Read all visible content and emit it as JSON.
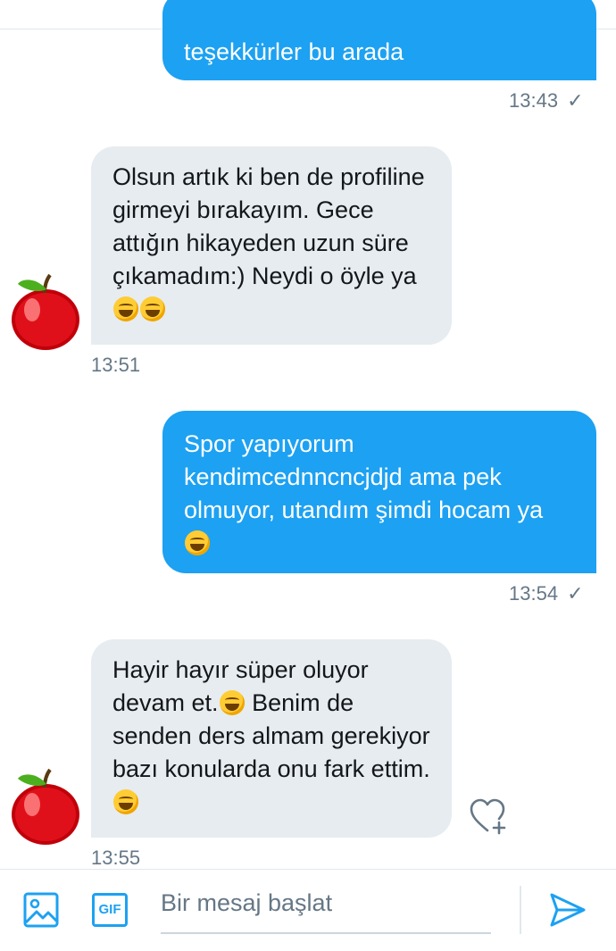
{
  "messages": [
    {
      "direction": "outgoing",
      "text": "teşekkürler bu arada",
      "time": "13:43"
    },
    {
      "direction": "incoming",
      "text": "Olsun artık ki ben de profiline girmeyi bırakayım. Gece attığın hikayeden uzun süre çıkamadım:) Neydi o öyle ya",
      "emojis": [
        "face-with-tears-of-joy",
        "face-with-tears-of-joy"
      ],
      "time": "13:51"
    },
    {
      "direction": "outgoing",
      "text": "Spor yapıyorum kendimcednncncjdjd ama pek olmuyor, utandım şimdi hocam ya",
      "emojis": [
        "face-with-tears-of-joy"
      ],
      "time": "13:54"
    },
    {
      "direction": "incoming",
      "text_part1": "Hayir hayır süper oluyor devam et.",
      "text_part2": " Benim de senden ders almam gerekiyor bazı konularda onu fark ettim.",
      "emojis": [
        "face-with-tears-of-joy",
        "face-with-tears-of-joy"
      ],
      "time": "13:55"
    }
  ],
  "read_indicator": "✓",
  "avatar_icon": "red-apple-icon",
  "reaction_icon": "heart-plus-icon",
  "composer": {
    "placeholder": "Bir mesaj başlat",
    "value": "",
    "image_icon": "image-icon",
    "gif_label": "GIF",
    "send_icon": "send-icon"
  },
  "colors": {
    "outgoing_bubble": "#1da1f2",
    "incoming_bubble": "#e6ecf0",
    "accent": "#1da1f2",
    "timestamp": "#657786"
  }
}
